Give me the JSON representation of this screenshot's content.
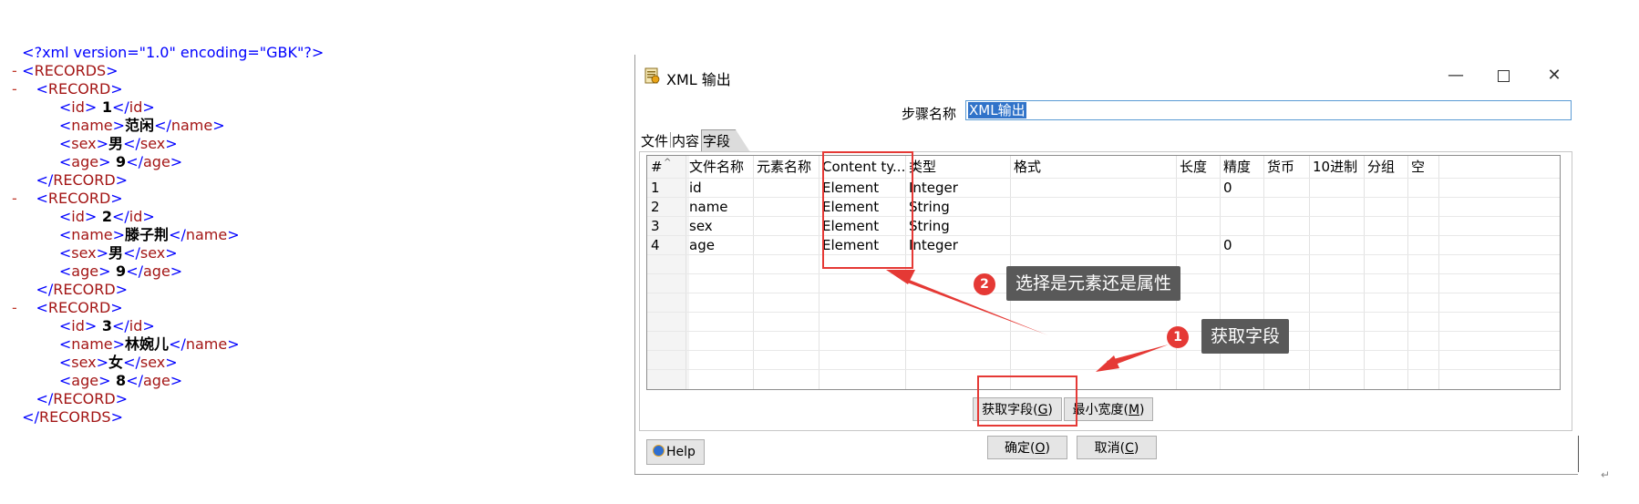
{
  "xml": {
    "lines": [
      {
        "indent": "  ",
        "toggle": "",
        "kind": "decl",
        "text": "<?xml version=\"1.0\" encoding=\"GBK\"?>"
      },
      {
        "indent": "  ",
        "toggle": "-",
        "kind": "open",
        "tag": "RECORDS"
      },
      {
        "indent": "     ",
        "toggle": "-",
        "kind": "open",
        "tag": "RECORD"
      },
      {
        "indent": "          ",
        "toggle": "",
        "kind": "elem",
        "tag": "id",
        "value": " 1"
      },
      {
        "indent": "          ",
        "toggle": "",
        "kind": "elem",
        "tag": "name",
        "value": "范闲"
      },
      {
        "indent": "          ",
        "toggle": "",
        "kind": "elem",
        "tag": "sex",
        "value": "男"
      },
      {
        "indent": "          ",
        "toggle": "",
        "kind": "elem",
        "tag": "age",
        "value": " 9"
      },
      {
        "indent": "     ",
        "toggle": "",
        "kind": "close",
        "tag": "RECORD"
      },
      {
        "indent": "     ",
        "toggle": "-",
        "kind": "open",
        "tag": "RECORD"
      },
      {
        "indent": "          ",
        "toggle": "",
        "kind": "elem",
        "tag": "id",
        "value": " 2"
      },
      {
        "indent": "          ",
        "toggle": "",
        "kind": "elem",
        "tag": "name",
        "value": "滕子荆"
      },
      {
        "indent": "          ",
        "toggle": "",
        "kind": "elem",
        "tag": "sex",
        "value": "男"
      },
      {
        "indent": "          ",
        "toggle": "",
        "kind": "elem",
        "tag": "age",
        "value": " 9"
      },
      {
        "indent": "     ",
        "toggle": "",
        "kind": "close",
        "tag": "RECORD"
      },
      {
        "indent": "     ",
        "toggle": "-",
        "kind": "open",
        "tag": "RECORD"
      },
      {
        "indent": "          ",
        "toggle": "",
        "kind": "elem",
        "tag": "id",
        "value": " 3"
      },
      {
        "indent": "          ",
        "toggle": "",
        "kind": "elem",
        "tag": "name",
        "value": "林婉儿"
      },
      {
        "indent": "          ",
        "toggle": "",
        "kind": "elem",
        "tag": "sex",
        "value": "女"
      },
      {
        "indent": "          ",
        "toggle": "",
        "kind": "elem",
        "tag": "age",
        "value": " 8"
      },
      {
        "indent": "     ",
        "toggle": "",
        "kind": "close",
        "tag": "RECORD"
      },
      {
        "indent": "  ",
        "toggle": "",
        "kind": "close",
        "tag": "RECORDS"
      }
    ]
  },
  "dialog": {
    "title": "XML 输出",
    "step_label": "步骤名称",
    "step_value": "XML输出",
    "tabs": {
      "file": "文件",
      "content": "内容",
      "fields": "字段"
    },
    "columns": [
      "#",
      "文件名称",
      "元素名称",
      "Content ty...",
      "类型",
      "格式",
      "长度",
      "精度",
      "货币",
      "10进制",
      "分组",
      "空"
    ],
    "rows": [
      [
        "1",
        "id",
        "",
        "Element",
        "Integer",
        "",
        "",
        "0",
        "",
        "",
        "",
        ""
      ],
      [
        "2",
        "name",
        "",
        "Element",
        "String",
        "",
        "",
        "",
        "",
        "",
        "",
        ""
      ],
      [
        "3",
        "sex",
        "",
        "Element",
        "String",
        "",
        "",
        "",
        "",
        "",
        "",
        ""
      ],
      [
        "4",
        "age",
        "",
        "Element",
        "Integer",
        "",
        "",
        "0",
        "",
        "",
        "",
        ""
      ]
    ],
    "buttons": {
      "get_fields": "获取字段",
      "get_fields_key": "G",
      "min_width": "最小宽度",
      "min_width_key": "M",
      "ok": "确定",
      "ok_key": "O",
      "cancel": "取消",
      "cancel_key": "C",
      "help": "Help"
    }
  },
  "annotations": {
    "callout1": {
      "number": "1",
      "text": "获取字段"
    },
    "callout2": {
      "number": "2",
      "text": "选择是元素还是属性"
    },
    "color": "#e53935"
  },
  "icons": {
    "title": "xml-document-icon",
    "help": "help-globe-icon"
  }
}
